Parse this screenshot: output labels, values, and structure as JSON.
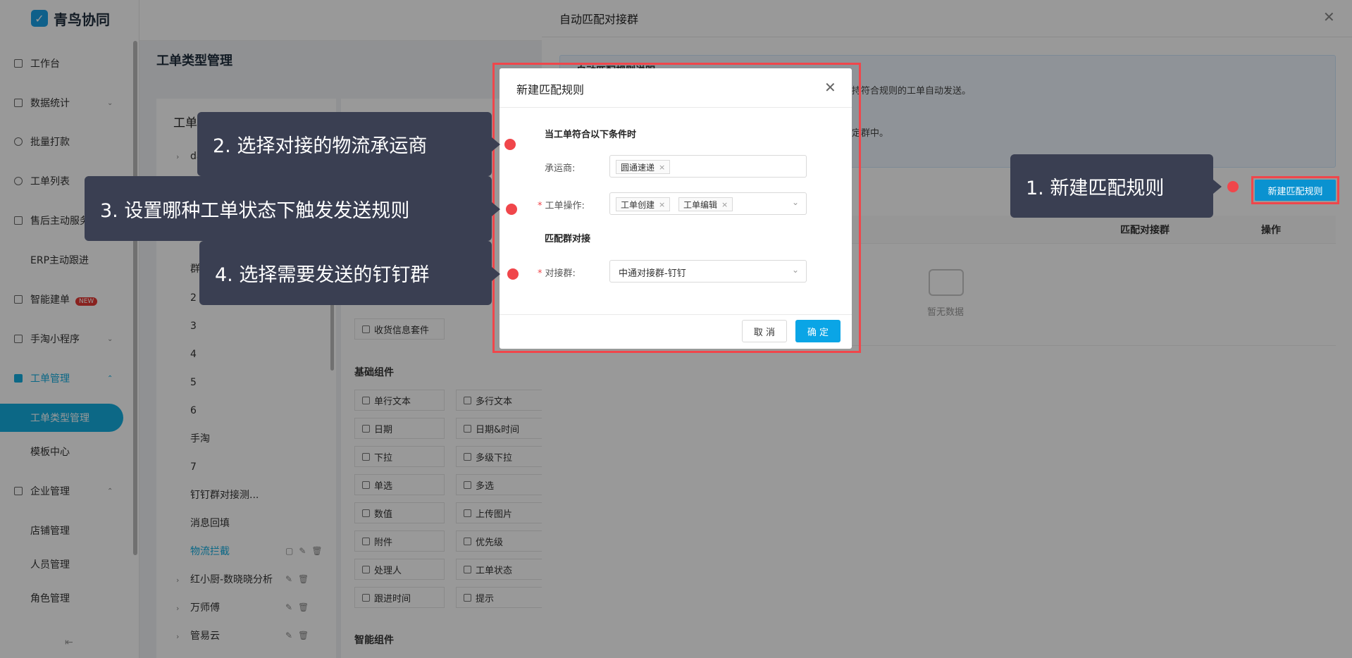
{
  "app": {
    "name": "青鸟协同"
  },
  "sidebar": {
    "items": [
      {
        "label": "工作台",
        "chevron": false
      },
      {
        "label": "数据统计",
        "chevron": true
      },
      {
        "label": "批量打款",
        "chevron": false
      },
      {
        "label": "工单列表",
        "chevron": false
      },
      {
        "label": "售后主动服务",
        "chevron": true
      },
      {
        "label": "ERP主动跟进",
        "chevron": false
      },
      {
        "label": "智能建单",
        "badge": "NEW"
      },
      {
        "label": "手淘小程序",
        "chevron": true
      },
      {
        "label": "工单管理",
        "chevron": true,
        "expanded": true
      },
      {
        "label": "工单类型管理",
        "active": true
      },
      {
        "label": "模板中心"
      },
      {
        "label": "企业管理",
        "chevron": true,
        "expanded": true
      },
      {
        "label": "店铺管理"
      },
      {
        "label": "人员管理"
      },
      {
        "label": "角色管理"
      }
    ]
  },
  "page": {
    "title": "工单类型管理"
  },
  "type_panel": {
    "title": "工单类型",
    "items": [
      "da",
      "群",
      "2",
      "3",
      "4",
      "5",
      "6",
      "手淘",
      "7",
      "钉钉群对接测...",
      "消息回填",
      "物流拦截",
      "红小厨-数晓晓分析",
      "万师傅",
      "管易云"
    ]
  },
  "components": {
    "shipping_label": "收货信息套件",
    "basic_heading": "基础组件",
    "basic": [
      "单行文本",
      "多行文本",
      "日期",
      "日期&时间",
      "下拉",
      "多级下拉",
      "单选",
      "多选",
      "数值",
      "上传图片",
      "附件",
      "优先级",
      "处理人",
      "工单状态",
      "跟进时间",
      "提示"
    ],
    "smart_heading": "智能组件"
  },
  "drawer": {
    "title": "自动匹配对接群",
    "info_title": "自动匹配规则说明",
    "info_line_1": "支持符合规则的工单自动发送。",
    "info_line_2": "指定群中。",
    "new_rule_button": "新建匹配规则",
    "columns": {
      "group": "匹配对接群",
      "operation": "操作"
    },
    "empty_text": "暂无数据"
  },
  "modal": {
    "title": "新建匹配规则",
    "section_condition": "当工单符合以下条件时",
    "carrier_label": "承运商:",
    "carrier_tags": [
      "圆通速递"
    ],
    "operation_label": "工单操作:",
    "operation_tags": [
      "工单创建",
      "工单编辑"
    ],
    "section_match": "匹配群对接",
    "group_label": "对接群:",
    "group_value": "中通对接群-钉钉",
    "cancel": "取 消",
    "ok": "确 定"
  },
  "callouts": {
    "step1": "1. 新建匹配规则",
    "step2": "2. 选择对接的物流承运商",
    "step3": "3. 设置哪种工单状态下触发发送规则",
    "step4": "4. 选择需要发送的钉钉群"
  },
  "colors": {
    "accent": "#0aa5e6",
    "highlight": "#f0464b",
    "callout_bg": "#3a3f52"
  }
}
